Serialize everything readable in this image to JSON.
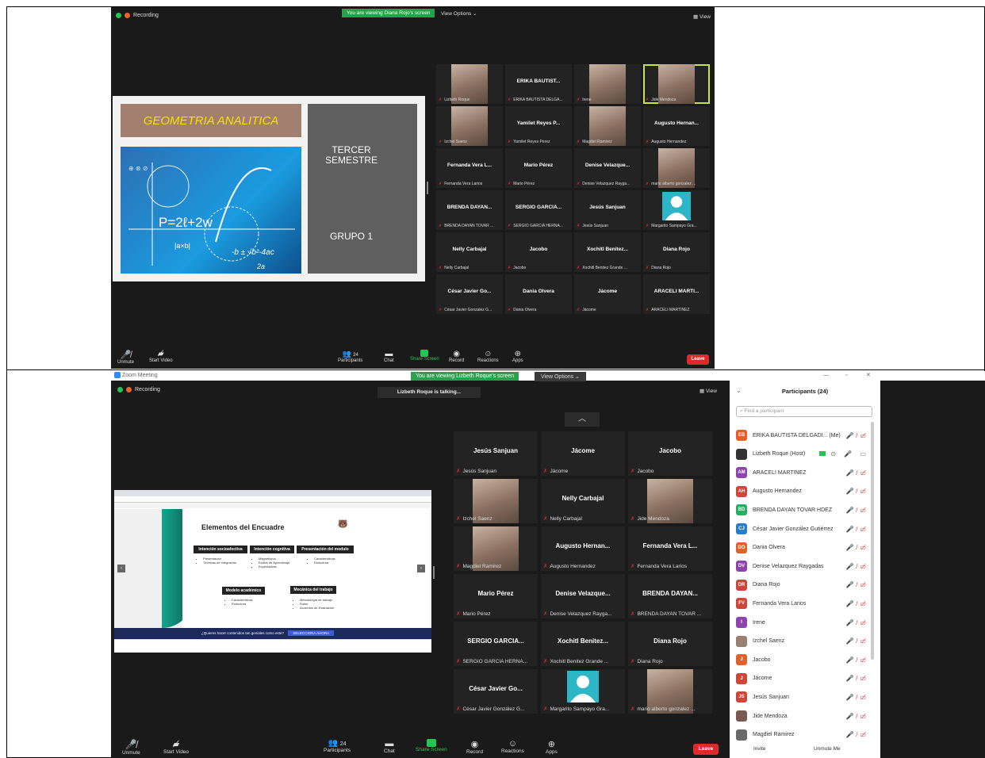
{
  "shot1": {
    "recording": "Recording",
    "banner": "You are viewing Diana Rojo's screen",
    "view_options": "View Options ⌄",
    "view": "View",
    "slide": {
      "title": "GEOMETRIA ANALITICA",
      "semester": "TERCER SEMESTRE",
      "group": "GRUPO 1",
      "formula": "P=2ℓ+2w",
      "formula2": "-b ± √b²-4ac",
      "formula3": "2a",
      "abx": "|a×b|"
    },
    "tiles": [
      {
        "name": "",
        "label": "Lizbeth Roque",
        "photo": true
      },
      {
        "name": "ERIKA BAUTIST...",
        "label": "ERIKA BAUTISTA DELGA..."
      },
      {
        "name": "",
        "label": "Irene",
        "photo": true
      },
      {
        "name": "",
        "label": "Jide Mendoza",
        "photo": true,
        "hl": true
      },
      {
        "name": "",
        "label": "Izchel Saenz",
        "photo": true
      },
      {
        "name": "Yamilet Reyes P...",
        "label": "Yamilet Reyes Perez"
      },
      {
        "name": "",
        "label": "Magdiel Ramirez",
        "photo": true
      },
      {
        "name": "Augusto Hernan...",
        "label": "Augusto Hernandez"
      },
      {
        "name": "Fernanda Vera L...",
        "label": "Fernanda Vera Larios"
      },
      {
        "name": "Mario Pérez",
        "label": "Mario Pérez"
      },
      {
        "name": "Denise Velazque...",
        "label": "Denise Velazquez Rayga..."
      },
      {
        "name": "",
        "label": "mario alberto gonzalez ...",
        "photo": true
      },
      {
        "name": "BRENDA DAYAN...",
        "label": "BRENDA DAYAN TOVAR ..."
      },
      {
        "name": "SERGIO GARCIA...",
        "label": "SERGIO GARCIA HERNA..."
      },
      {
        "name": "Jesús Sanjuan",
        "label": "Jesús Sanjuan"
      },
      {
        "name": "",
        "label": "Margarito Sampayo Gra...",
        "avatar": true
      },
      {
        "name": "Nelly Carbajal",
        "label": "Nelly Carbajal"
      },
      {
        "name": "Jacobo",
        "label": "Jacobo"
      },
      {
        "name": "Xochitl Benitez...",
        "label": "Xochitl Benitez Grande ..."
      },
      {
        "name": "Diana Rojo",
        "label": "Diana Rojo"
      },
      {
        "name": "César Javier Go...",
        "label": "César Javier Gonzalez G..."
      },
      {
        "name": "Dania Olvera",
        "label": "Dania Olvera"
      },
      {
        "name": "Jácome",
        "label": "Jácome"
      },
      {
        "name": "ARACELI MARTI...",
        "label": "ARACELI MARTINEZ"
      }
    ],
    "toolbar": {
      "unmute": "Unmute",
      "start_video": "Start Video",
      "participants": "Participants",
      "count": "24",
      "chat": "Chat",
      "share": "Share Screen",
      "record": "Record",
      "reactions": "Reactions",
      "apps": "Apps",
      "leave": "Leave"
    }
  },
  "shot2": {
    "app_title": "Zoom Meeting",
    "recording": "Recording",
    "banner": "You are viewing Lizbeth Roque's screen",
    "view_options": "View Options ⌄",
    "talking": "Lizbeth Roque is talking...",
    "view": "View",
    "slide": {
      "heading": "Elementos del Encuadre",
      "box1": "Intención socioafectiva",
      "box2": "Intención cognitiva",
      "box3": "Presentación del modulo",
      "box4": "Modelo académico",
      "box5": "Mecánica del trabajo",
      "items1": [
        "Presentación",
        "Técnicas de integración"
      ],
      "items2": [
        "Magnetismo",
        "Estilos de Aprendizaje",
        "Expectativas"
      ],
      "items3": [
        "Características",
        "Estructura"
      ],
      "items4": [
        "Características",
        "Estructura"
      ],
      "items5": [
        "Metodología de trabajo",
        "Roles",
        "Acuerdos de Evaluación"
      ],
      "footer": "¿Quieres hacer contenidos tan geniales como este?",
      "footer_btn": "SELECCIONA AHORA"
    },
    "tiles": [
      {
        "name": "Jesús Sanjuan",
        "label": "Jesús Sanjuan"
      },
      {
        "name": "Jácome",
        "label": "Jácome"
      },
      {
        "name": "Jacobo",
        "label": "Jacobo"
      },
      {
        "name": "",
        "label": "Izchel Saenz",
        "photo": true
      },
      {
        "name": "Nelly Carbajal",
        "label": "Nelly Carbajal"
      },
      {
        "name": "",
        "label": "Jide Mendoza",
        "photo": true
      },
      {
        "name": "",
        "label": "Magdiel Ramirez",
        "photo": true
      },
      {
        "name": "Augusto Hernan...",
        "label": "Augusto Hernandez"
      },
      {
        "name": "Fernanda Vera L...",
        "label": "Fernanda Vera Larios"
      },
      {
        "name": "Mario Pérez",
        "label": "Mario Pérez"
      },
      {
        "name": "Denise Velazque...",
        "label": "Denise Velazquez Rayga..."
      },
      {
        "name": "BRENDA DAYAN...",
        "label": "BRENDA DAYAN TOVAR ..."
      },
      {
        "name": "SERGIO GARCIA...",
        "label": "SERGIO GARCIA HERNA..."
      },
      {
        "name": "Xochitl Benitez...",
        "label": "Xochitl Benitez Grande ..."
      },
      {
        "name": "Diana Rojo",
        "label": "Diana Rojo"
      },
      {
        "name": "César Javier Go...",
        "label": "César Javier González G..."
      },
      {
        "name": "",
        "label": "Margarito Sampayo Gra...",
        "avatar": true
      },
      {
        "name": "",
        "label": "mario alberto gonzalez ...",
        "photo": true
      }
    ],
    "toolbar": {
      "unmute": "Unmute",
      "start_video": "Start Video",
      "participants": "Participants",
      "count": "24",
      "chat": "Chat",
      "share": "Share Screen",
      "record": "Record",
      "reactions": "Reactions",
      "apps": "Apps",
      "leave": "Leave"
    },
    "panel": {
      "title": "Participants (24)",
      "search_placeholder": "Find a participant",
      "invite": "Invite",
      "unmute_me": "Unmute Me",
      "people": [
        {
          "initials": "EB",
          "name": "ERIKA BAUTISTA DELGADI... (Me)",
          "color": "#e0622a"
        },
        {
          "initials": "",
          "name": "Lizbeth Roque (Host)",
          "color": "#333333"
        },
        {
          "initials": "AM",
          "name": "ARACELI MARTINEZ",
          "color": "#8e44ad"
        },
        {
          "initials": "AH",
          "name": "Augusto Hernandez",
          "color": "#d0453a"
        },
        {
          "initials": "BD",
          "name": "BRENDA DAYAN TOVAR HDEZ",
          "color": "#27ae60"
        },
        {
          "initials": "CJ",
          "name": "César Javier González Gutiérrez",
          "color": "#2a7ec8"
        },
        {
          "initials": "DO",
          "name": "Dania Olvera",
          "color": "#e0622a"
        },
        {
          "initials": "DV",
          "name": "Denise Velazquez Raygadas",
          "color": "#8e44ad"
        },
        {
          "initials": "DR",
          "name": "Diana Rojo",
          "color": "#d0453a"
        },
        {
          "initials": "FV",
          "name": "Fernanda Vera Larios",
          "color": "#d0453a"
        },
        {
          "initials": "I",
          "name": "Irene",
          "color": "#8e44ad"
        },
        {
          "initials": "",
          "name": "Izchel Saenz",
          "color": "#9a8070"
        },
        {
          "initials": "J",
          "name": "Jacobo",
          "color": "#e0622a"
        },
        {
          "initials": "J",
          "name": "Jácome",
          "color": "#d0453a"
        },
        {
          "initials": "JS",
          "name": "Jesús Sanjuan",
          "color": "#d0453a"
        },
        {
          "initials": "",
          "name": "Jide Mendoza",
          "color": "#7a5a50"
        },
        {
          "initials": "",
          "name": "Magdiel Ramirez",
          "color": "#6a6a6a"
        }
      ]
    }
  }
}
